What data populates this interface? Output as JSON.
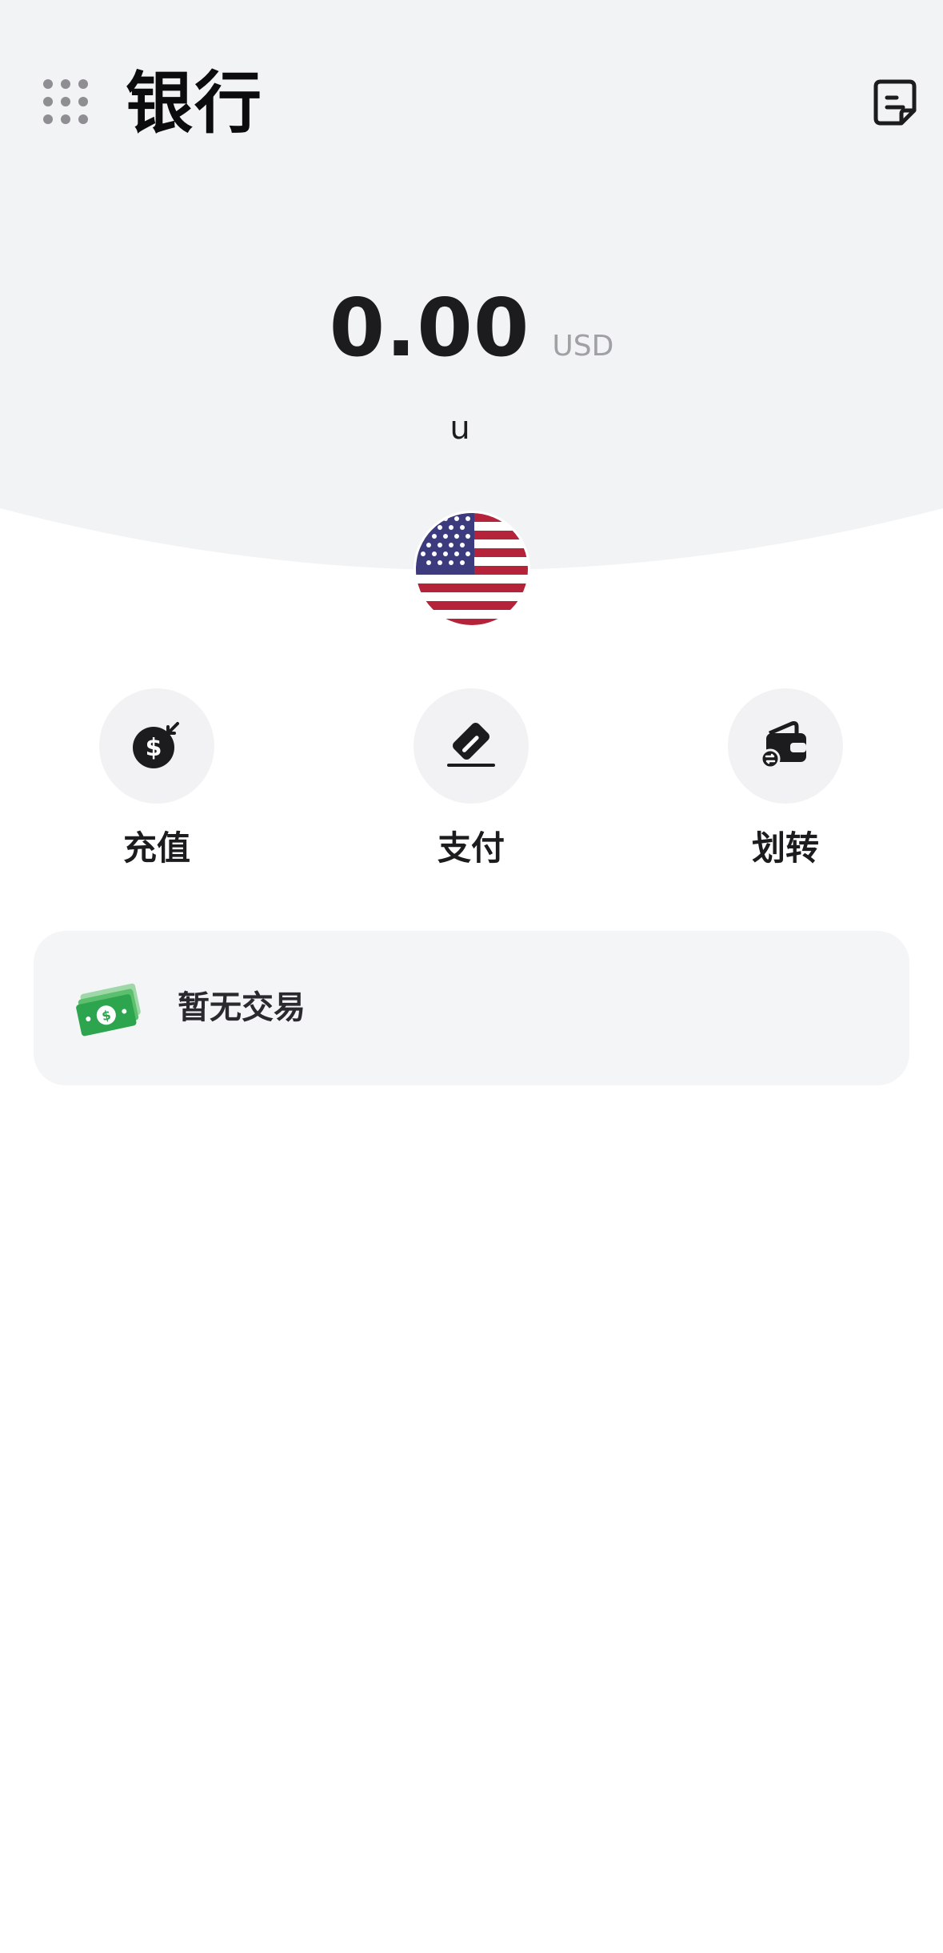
{
  "header": {
    "title": "银行",
    "apps_icon": "grid-dots-icon",
    "statement_icon": "statement-icon"
  },
  "balance": {
    "amount": "0.00",
    "currency": "USD",
    "account_name": "u",
    "flag_icon": "us-flag-icon"
  },
  "actions": [
    {
      "label": "充值",
      "icon": "dollar-bag-icon"
    },
    {
      "label": "支付",
      "icon": "pay-card-icon"
    },
    {
      "label": "划转",
      "icon": "wallet-transfer-icon"
    }
  ],
  "transactions": {
    "empty_text": "暂无交易",
    "icon": "money-stack-icon"
  },
  "colors": {
    "header_bg": "#f2f3f5",
    "text": "#1c1c1e",
    "muted": "#a0a0a5",
    "money_green": "#2da44e",
    "flag_red": "#b5233a",
    "flag_blue": "#3b3b7d"
  }
}
